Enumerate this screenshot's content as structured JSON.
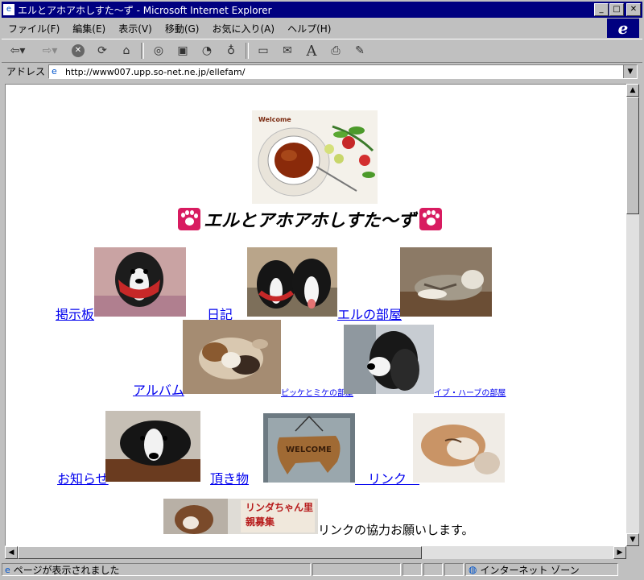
{
  "window": {
    "title": "エルとアホアホしすた〜ず - Microsoft Internet Explorer"
  },
  "menu": [
    "ファイル(F)",
    "編集(E)",
    "表示(V)",
    "移動(G)",
    "お気に入り(A)",
    "ヘルプ(H)"
  ],
  "toolbar": [
    "back-icon",
    "forward-icon",
    "stop-icon",
    "refresh-icon",
    "home-icon",
    "search-icon",
    "favorites-icon",
    "history-icon",
    "channels-icon",
    "fullscreen-icon",
    "mail-icon",
    "font-icon",
    "print-icon",
    "edit-icon"
  ],
  "address": {
    "label": "アドレス",
    "url": "http://www007.upp.so-net.ne.jp/ellefam/"
  },
  "page": {
    "heading": "エルとアホアホしすた〜ず",
    "welcome": "Welcome",
    "links": {
      "bbs": "掲示板",
      "diary": "　日記　",
      "elle_room": "エルの部屋",
      "album": "アルバム",
      "pikke_mike": "ピッケとミケの部屋",
      "eve_herb": "イブ・ハーブの部屋",
      "news": "お知らせ",
      "gifts": "頂き物",
      "link": "　リンク　"
    },
    "banner_text": "リンダちゃん里親募集",
    "footer_text": "リンクの協力お願いします。"
  },
  "status": {
    "left": "ページが表示されました",
    "zone": "インターネット ゾーン"
  },
  "colors": {
    "titlebar": "#000080",
    "link": "#0000ee",
    "paw": "#d81b60",
    "chrome": "#c0c0c0"
  }
}
